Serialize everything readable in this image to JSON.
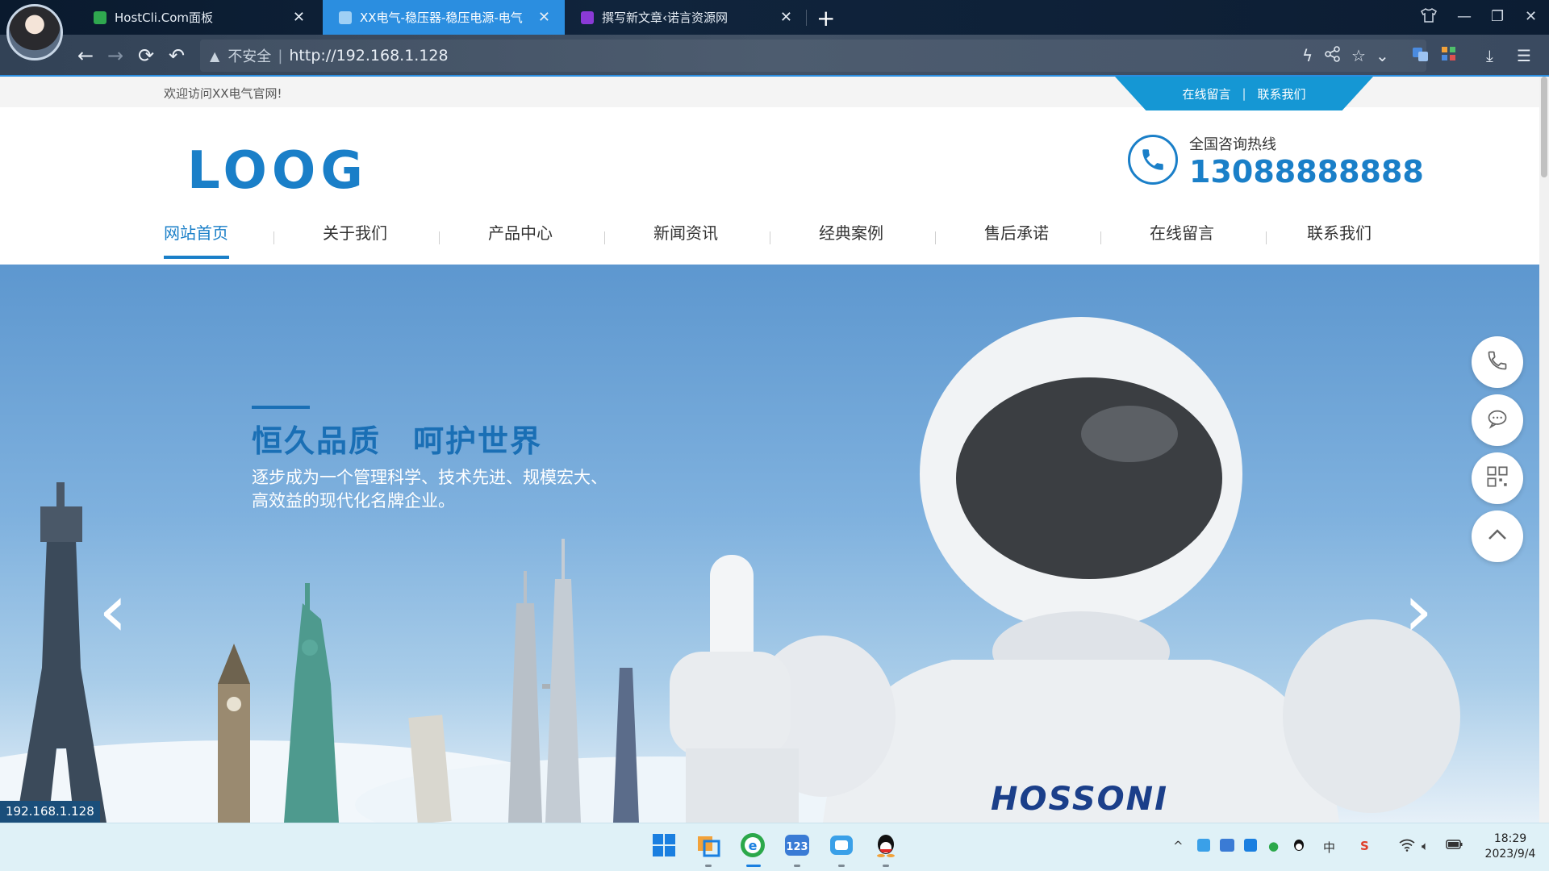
{
  "browser": {
    "tabs": [
      {
        "title": "HostCli.Com面板",
        "active": false
      },
      {
        "title": "XX电气-稳压器-稳压电源-电气",
        "active": true
      },
      {
        "title": "撰写新文章‹诺言资源网",
        "active": false
      }
    ],
    "address": {
      "security_label": "不安全",
      "url": "http://192.168.1.128"
    }
  },
  "site": {
    "welcome": "欢迎访问XX电气官网!",
    "toplinks": [
      "在线留言",
      "联系我们"
    ],
    "logo_text": "LOOG",
    "hotline_label": "全国咨询热线",
    "hotline_number": "13088888888",
    "nav": [
      {
        "label": "网站首页",
        "active": true
      },
      {
        "label": "关于我们",
        "active": false
      },
      {
        "label": "产品中心",
        "active": false
      },
      {
        "label": "新闻资讯",
        "active": false
      },
      {
        "label": "经典案例",
        "active": false
      },
      {
        "label": "售后承诺",
        "active": false
      },
      {
        "label": "在线留言",
        "active": false
      },
      {
        "label": "联系我们",
        "active": false
      }
    ],
    "banner": {
      "slogan": "恒久品质　呵护世界",
      "subtext": "逐步成为一个管理科学、技术先进、规模宏大、高效益的现代化名牌企业。",
      "brand": "HOSSONI"
    },
    "side_buttons": [
      "phone-icon",
      "chat-icon",
      "qrcode-icon",
      "back-to-top-icon"
    ]
  },
  "status_url": "192.168.1.128",
  "taskbar": {
    "clock_time": "18:29",
    "clock_date": "2023/9/4",
    "ime": "中"
  },
  "colors": {
    "brand_blue": "#1a7fc8",
    "top_link_bar": "#1597d4",
    "active_tab": "#2b8ee0"
  }
}
